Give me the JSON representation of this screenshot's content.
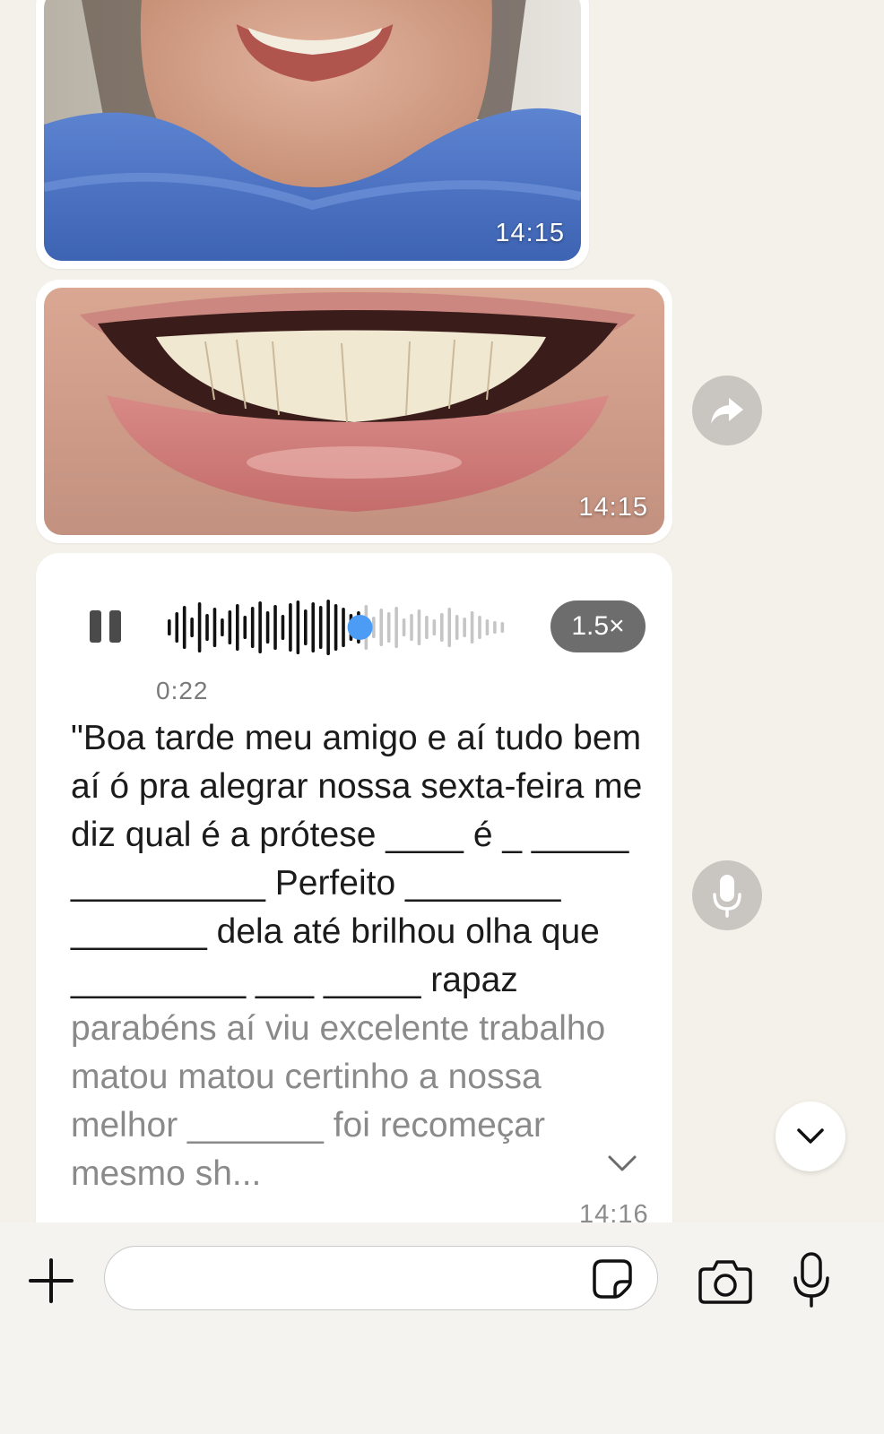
{
  "messages": {
    "image1": {
      "time": "14:15",
      "subject": "smiling-woman-blue-towel"
    },
    "image2": {
      "time": "14:15",
      "subject": "close-up-smile-teeth"
    },
    "voice": {
      "duration": "0:22",
      "speed": "1.5×",
      "progress": 0.57,
      "time": "14:16",
      "transcript_main": "\"Boa tarde meu amigo e aí tudo bem aí ó pra alegrar nossa sexta-feira me diz qual é a prótese ____ é _ _____ __________ Perfeito ________ _______ dela até brilhou olha que _________ ___ _____ rapaz",
      "transcript_faded": " parabéns aí viu excelente trabalho matou matou certinho a nossa melhor _______ foi recomeçar mesmo sh..."
    }
  },
  "icons": {
    "forward": "forward-arrow-icon",
    "mic_float": "microphone-icon",
    "scroll_down": "chevron-down-icon",
    "plus": "plus-icon",
    "sticker": "sticker-icon",
    "camera": "camera-icon",
    "mic": "microphone-icon"
  },
  "composer": {
    "placeholder": ""
  },
  "colors": {
    "background": "#f4f1ea",
    "waveform_played": "#111111",
    "waveform_unplayed": "#c5c5c5",
    "progress_dot": "#4c9bf5",
    "speed_pill": "#6d6d6d"
  }
}
